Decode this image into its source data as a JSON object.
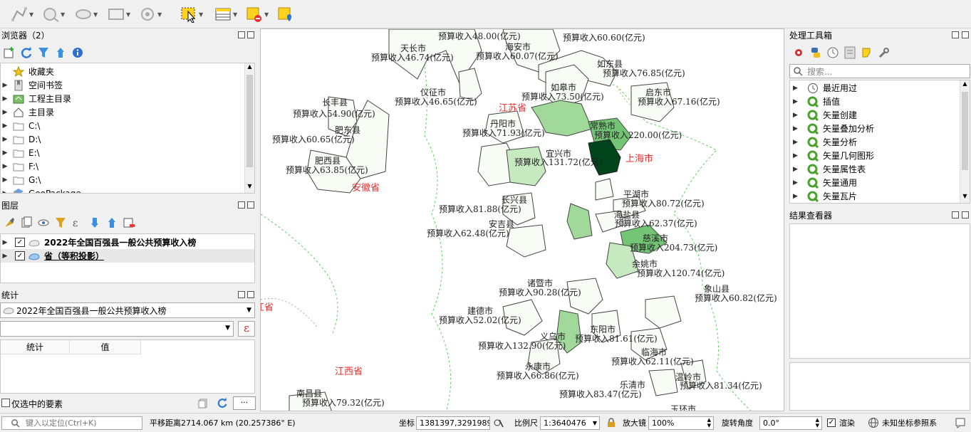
{
  "toolbar": {
    "buttons": [
      {
        "name": "digitize-tool-icon"
      },
      {
        "name": "add-feature-icon"
      },
      {
        "name": "vertex-tool-icon"
      },
      {
        "name": "modify-attributes-icon"
      },
      {
        "name": "delete-feature-icon"
      },
      {
        "name": "select-features-icon"
      },
      {
        "name": "attribute-table-icon"
      },
      {
        "name": "deselect-features-icon"
      },
      {
        "name": "identify-features-icon"
      }
    ]
  },
  "browser": {
    "title": "浏览器（2）",
    "items": [
      {
        "label": "收藏夹",
        "icon": "star-icon"
      },
      {
        "label": "空间书签",
        "icon": "bookmark-icon"
      },
      {
        "label": "工程主目录",
        "icon": "project-home-icon"
      },
      {
        "label": "主目录",
        "icon": "home-icon"
      },
      {
        "label": "C:\\",
        "icon": "folder-icon"
      },
      {
        "label": "D:\\",
        "icon": "folder-icon"
      },
      {
        "label": "E:\\",
        "icon": "folder-icon"
      },
      {
        "label": "F:\\",
        "icon": "folder-icon"
      },
      {
        "label": "G:\\",
        "icon": "folder-icon"
      },
      {
        "label": "GeoPackage",
        "icon": "geopackage-icon"
      }
    ]
  },
  "layers": {
    "title": "图层",
    "items": [
      {
        "label": "2022年全国百强县一般公共预算收入榜",
        "checked": true
      },
      {
        "label": "省（等积投影）",
        "checked": true
      }
    ]
  },
  "stats": {
    "title": "统计",
    "layer": "2022年全国百强县一般公共预算收入榜",
    "col_stat": "统计",
    "col_value": "值",
    "selected_only": "仅选中的要素",
    "more": "···"
  },
  "processing": {
    "title": "处理工具箱",
    "search_placeholder": "搜索...",
    "items": [
      "最近用过",
      "插值",
      "矢量创建",
      "矢量叠加分析",
      "矢量分析",
      "矢量几何图形",
      "矢量属性表",
      "矢量通用",
      "矢量瓦片"
    ]
  },
  "results": {
    "title": "结果查看器"
  },
  "map": {
    "labels": [
      "天长市",
      "预算收入46.74(亿元)",
      "预算收入48.00(亿元)",
      "预算收入60.60(亿元)",
      "海安市",
      "预算收入60.07(亿元)",
      "如东县",
      "预算收入76.85(亿元)",
      "如皋市",
      "预算收入73.50(亿元)",
      "仪征市",
      "预算收入46.65(亿元)",
      "启东市",
      "预算收入67.16(亿元)",
      "长丰县",
      "预算收入54.90(亿元)",
      "丹阳市",
      "预算收入71.93(亿元)",
      "常熟市",
      "预算收入220.00(亿元)",
      "肥东县",
      "预算收入60.65(亿元)",
      "宜兴市",
      "预算收入131.72(亿元)",
      "肥西县",
      "预算收入63.85(亿元)",
      "平湖市",
      "预算收入80.72(亿元)",
      "长兴县",
      "预算收入81.88(亿元)",
      "海盐县",
      "预算收入62.37(亿元)",
      "安吉县",
      "预算收入62.48(亿元)",
      "慈溪市",
      "预算收入204.73(亿元)",
      "余姚市",
      "预算收入120.74(亿元)",
      "诸暨市",
      "预算收入90.28(亿元)",
      "象山县",
      "预算收入60.82(亿元)",
      "建德市",
      "预算收入52.02(亿元)",
      "东阳市",
      "预算收入81.61(亿元)",
      "义乌市",
      "预算收入132.90(亿元)",
      "临海市",
      "预算收入62.11(亿元)",
      "永康市",
      "预算收入66.86(亿元)",
      "温岭市",
      "预算收入81.34(亿元)",
      "乐清市",
      "预算收入83.47(亿元)",
      "南昌县",
      "预算收入79.32(亿元)",
      "玉环市"
    ],
    "provinces": [
      "江苏省",
      "上海市",
      "安徽省",
      "浙江省",
      "江西省"
    ]
  },
  "status": {
    "locate_placeholder": "键入以定位(Ctrl+K)",
    "pan": "平移距离2714.067 km (20.257386° E)",
    "coord_label": "坐标",
    "coord_value": "1381397,3291989",
    "scale_label": "比例尺",
    "scale_value": "1:3640476",
    "magnifier_label": "放大镜",
    "magnifier_value": "100%",
    "rotation_label": "旋转角度",
    "rotation_value": "0.0°",
    "render_label": "渲染",
    "crs_label": "未知坐标参照系"
  }
}
